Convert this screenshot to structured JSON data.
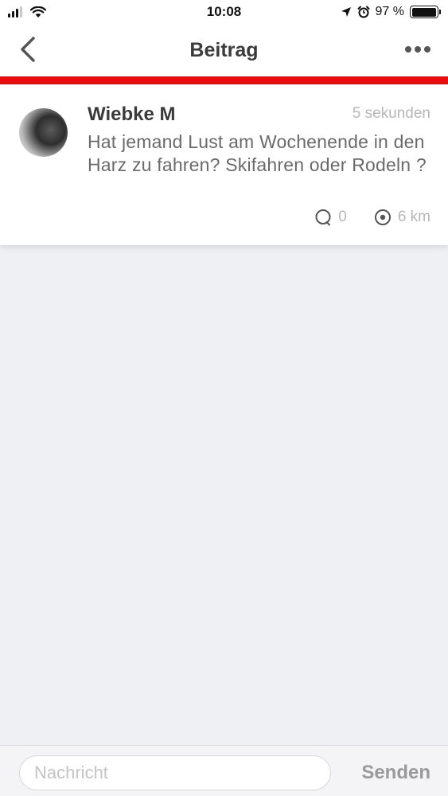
{
  "status_bar": {
    "time": "10:08",
    "battery": "97 %",
    "battery_level": 0.97,
    "icons": [
      "signal-icon",
      "wifi-icon",
      "location-arrow-icon",
      "alarm-icon",
      "battery-icon"
    ]
  },
  "nav": {
    "title": "Beitrag",
    "back_icon": "chevron-left-icon",
    "more_icon": "more-dots-icon"
  },
  "accent_color": "#e80e0e",
  "post": {
    "author": "Wiebke M",
    "time": "5 sekunden",
    "text": "Hat jemand Lust am Wochenende in den Harz zu fahren? Skifahren oder Rodeln ?",
    "comments_count": "0",
    "distance": "6 km"
  },
  "composer": {
    "placeholder": "Nachricht",
    "send_label": "Senden"
  }
}
